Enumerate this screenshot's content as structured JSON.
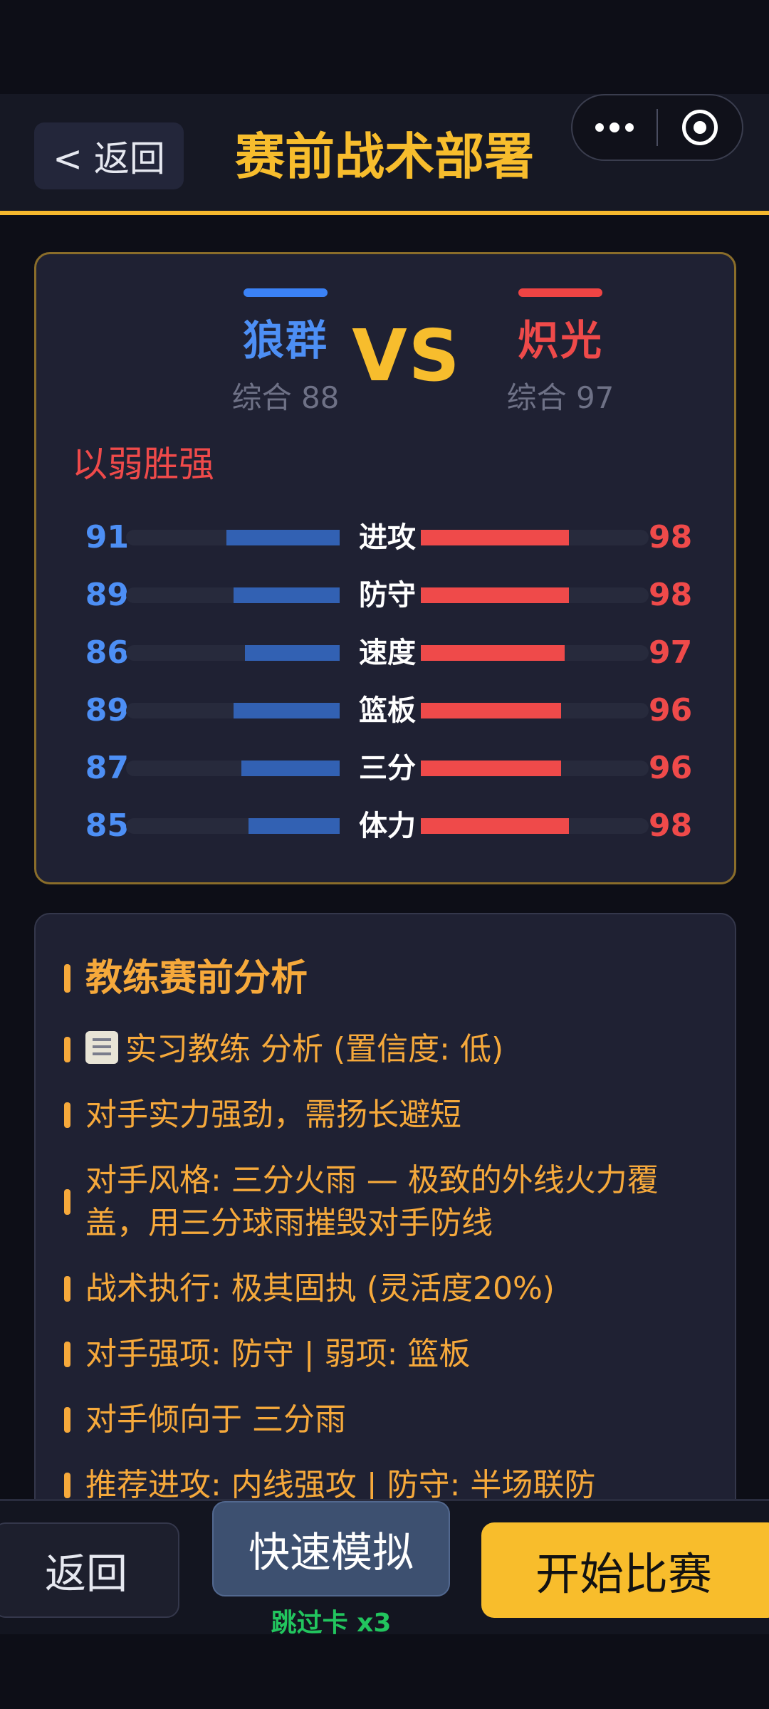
{
  "header": {
    "back_label": "< 返回",
    "title": "赛前战术部署"
  },
  "matchup": {
    "home": {
      "name": "狼群",
      "rating": "综合 88",
      "color": "#4d8ff5"
    },
    "vs": "VS",
    "away": {
      "name": "炽光",
      "rating": "综合 97",
      "color": "#ef4a4a"
    },
    "tag": "以弱胜强",
    "stats": [
      {
        "label": "进攻",
        "home": 91,
        "away": 98
      },
      {
        "label": "防守",
        "home": 89,
        "away": 98
      },
      {
        "label": "速度",
        "home": 86,
        "away": 97
      },
      {
        "label": "篮板",
        "home": 89,
        "away": 96
      },
      {
        "label": "三分",
        "home": 87,
        "away": 96
      },
      {
        "label": "体力",
        "home": 85,
        "away": 98
      }
    ]
  },
  "analysis": {
    "title": "教练赛前分析",
    "coach_line": "实习教练 分析 (置信度: 低)",
    "lines": [
      "对手实力强劲，需扬长避短",
      "对手风格: 三分火雨 — 极致的外线火力覆盖，用三分球雨摧毁对手防线",
      "战术执行: 极其固执 (灵活度20%)",
      "对手强项: 防守 | 弱项: 篮板",
      "对手倾向于 三分雨",
      "推荐进攻: 内线强攻 | 防守: 半场联防"
    ]
  },
  "actions": {
    "back": "返回",
    "quick_sim": "快速模拟",
    "skip_cards": "跳过卡 x3",
    "start": "开始比赛"
  },
  "colors": {
    "accent": "#f7bd2d",
    "home": "#4d8ff5",
    "away": "#ef4a4a",
    "skip": "#22c55e"
  }
}
